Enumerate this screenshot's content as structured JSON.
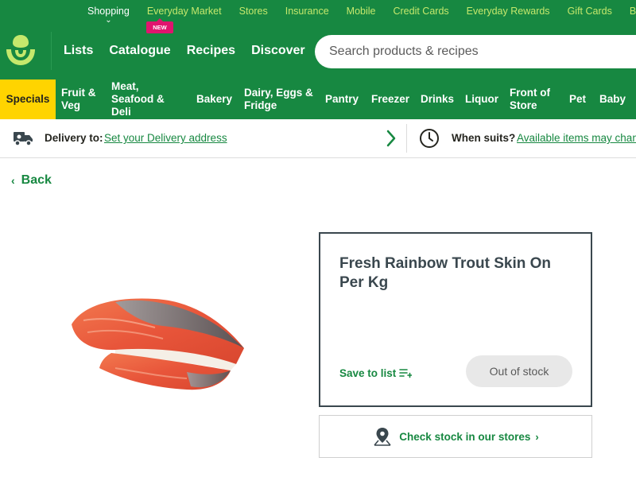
{
  "topbar": {
    "links": [
      {
        "label": "Shopping",
        "active": true
      },
      {
        "label": "Everyday Market"
      },
      {
        "label": "Stores"
      },
      {
        "label": "Insurance"
      },
      {
        "label": "Mobile"
      },
      {
        "label": "Credit Cards"
      },
      {
        "label": "Everyday Rewards"
      },
      {
        "label": "Gift Cards"
      },
      {
        "label": "Business"
      }
    ],
    "new_badge": "NEW"
  },
  "header": {
    "nav": [
      "Lists",
      "Catalogue",
      "Recipes",
      "Discover"
    ],
    "search_placeholder": "Search products & recipes"
  },
  "categories": [
    "Specials",
    "Fruit &\nVeg",
    "Meat,\nSeafood &\nDeli",
    "Bakery",
    "Dairy, Eggs &\nFridge",
    "Pantry",
    "Freezer",
    "Drinks",
    "Liquor",
    "Front of\nStore",
    "Pet",
    "Baby"
  ],
  "delivery": {
    "label": "Delivery to:",
    "link": "Set your Delivery address",
    "when_label": "When suits?",
    "when_link": "Available items may change"
  },
  "content": {
    "back": "Back",
    "product": {
      "title": "Fresh Rainbow Trout Skin On Per Kg",
      "save_label": "Save to list",
      "stock_status": "Out of stock",
      "check_stock": "Check stock in our stores"
    }
  },
  "colors": {
    "brand_green": "#178841",
    "accent_lime": "#c5e86c",
    "specials_yellow": "#ffd400",
    "new_badge_pink": "#e0146e"
  },
  "icons": [
    "woolworths-logo",
    "truck-icon",
    "chevron-right-icon",
    "clock-icon",
    "chevron-left-icon",
    "list-add-icon",
    "location-pin-icon"
  ]
}
